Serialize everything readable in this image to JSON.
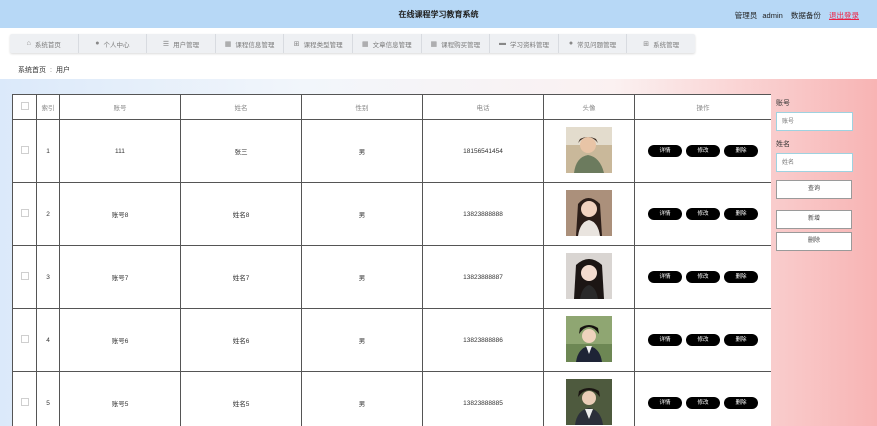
{
  "header": {
    "title": "在线课程学习教育系统",
    "role": "管理员",
    "username": "admin",
    "backup": "数据备份",
    "logout": "退出登录"
  },
  "nav": [
    {
      "label": "系统首页",
      "icon": "home-icon",
      "glyph": "⌂"
    },
    {
      "label": "个人中心",
      "icon": "person-icon",
      "glyph": "●"
    },
    {
      "label": "用户管理",
      "icon": "list-icon",
      "glyph": "☰"
    },
    {
      "label": "课程信息管理",
      "icon": "grid-icon",
      "glyph": "▦"
    },
    {
      "label": "课程类型管理",
      "icon": "apps-icon",
      "glyph": "⊞"
    },
    {
      "label": "文章信息管理",
      "icon": "grid-icon",
      "glyph": "▦"
    },
    {
      "label": "课程购买管理",
      "icon": "grid-icon",
      "glyph": "▦"
    },
    {
      "label": "学习资料管理",
      "icon": "card-icon",
      "glyph": "▬"
    },
    {
      "label": "常见问题管理",
      "icon": "users-icon",
      "glyph": "●"
    },
    {
      "label": "系统管理",
      "icon": "apps-icon",
      "glyph": "⊞"
    }
  ],
  "breadcrumb": {
    "home": "系统首页",
    "sep": ":",
    "current": "用户"
  },
  "table": {
    "headers": [
      "索引",
      "账号",
      "姓名",
      "性别",
      "电话",
      "头像",
      "操作"
    ],
    "rows": [
      {
        "index": "1",
        "account": "111",
        "name": "张三",
        "gender": "男",
        "phone": "18156541454"
      },
      {
        "index": "2",
        "account": "账号8",
        "name": "姓名8",
        "gender": "男",
        "phone": "13823888888"
      },
      {
        "index": "3",
        "account": "账号7",
        "name": "姓名7",
        "gender": "男",
        "phone": "13823888887"
      },
      {
        "index": "4",
        "account": "账号6",
        "name": "姓名6",
        "gender": "男",
        "phone": "13823888886"
      },
      {
        "index": "5",
        "account": "账号5",
        "name": "姓名5",
        "gender": "男",
        "phone": "13823888885"
      }
    ],
    "ops": {
      "detail": "详情",
      "edit": "修改",
      "delete": "删除"
    }
  },
  "search": {
    "account_label": "账号",
    "account_placeholder": "账号",
    "name_label": "姓名",
    "name_placeholder": "姓名",
    "query_button": "查询",
    "add_button": "新增",
    "delete_button": "删除"
  },
  "colors": {
    "header_bg": "#b7d8f6",
    "button_black": "#000000",
    "logout_red": "#e22244",
    "input_border": "#9ed2e0"
  }
}
